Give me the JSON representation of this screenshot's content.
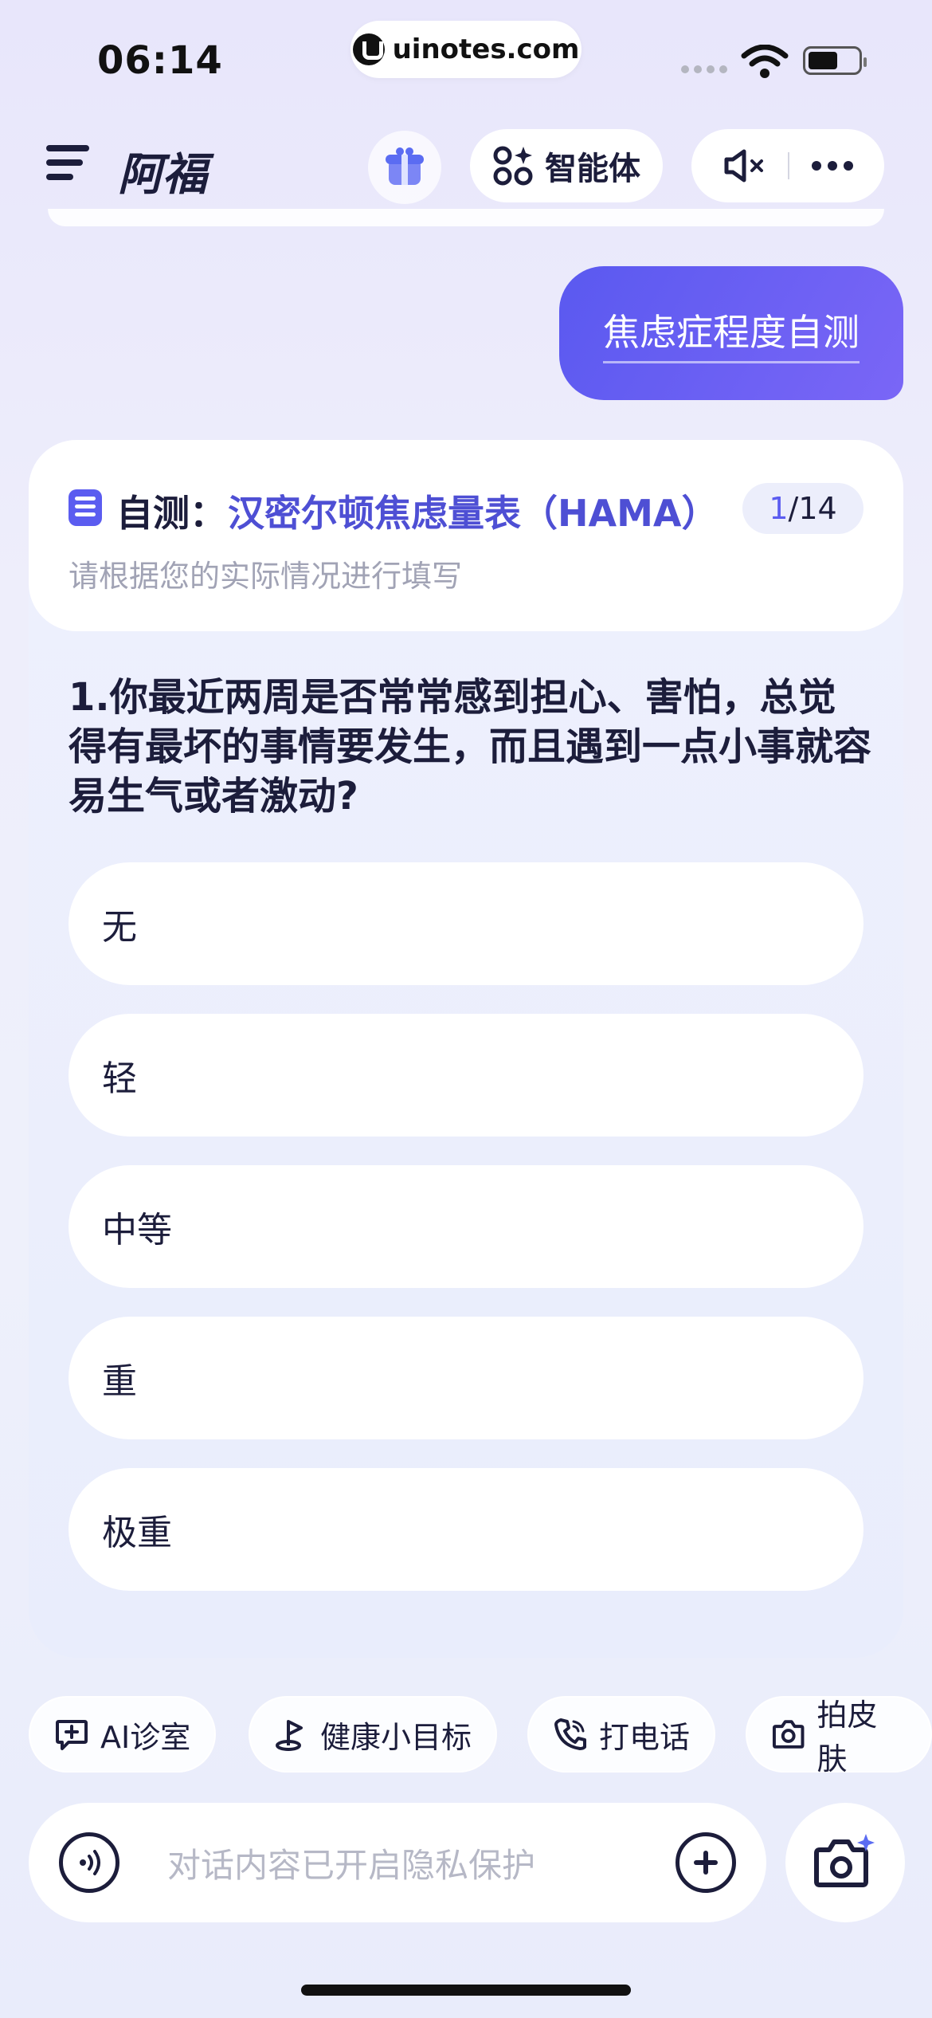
{
  "status_bar": {
    "time": "06:14",
    "url": "uinotes.com"
  },
  "header": {
    "title": "阿福",
    "agent_label": "智能体",
    "icons": [
      "menu-icon",
      "gift-icon",
      "agent-grid-icon",
      "mute-icon",
      "more-icon"
    ]
  },
  "user_message": {
    "text": "焦虑症程度自测"
  },
  "quiz": {
    "label": "自测：",
    "name": "汉密尔顿焦虑量表（HAMA）",
    "current": "1",
    "separator": "/",
    "total": "14",
    "subtitle": "请根据您的实际情况进行填写",
    "question": "1.你最近两周是否常常感到担心、害怕，总觉得有最坏的事情要发生，而且遇到一点小事就容易生气或者激动?",
    "options": [
      "无",
      "轻",
      "中等",
      "重",
      "极重"
    ]
  },
  "quick_actions": [
    {
      "label": "AI诊室",
      "icon": "chat-plus-icon"
    },
    {
      "label": "健康小目标",
      "icon": "flag-icon"
    },
    {
      "label": "打电话",
      "icon": "phone-icon"
    },
    {
      "label": "拍皮肤",
      "icon": "camera-icon"
    }
  ],
  "input": {
    "placeholder": "对话内容已开启隐私保护"
  },
  "colors": {
    "accent": "#5b5cf0",
    "text": "#1c1d3b",
    "muted": "#a1a3b5"
  }
}
